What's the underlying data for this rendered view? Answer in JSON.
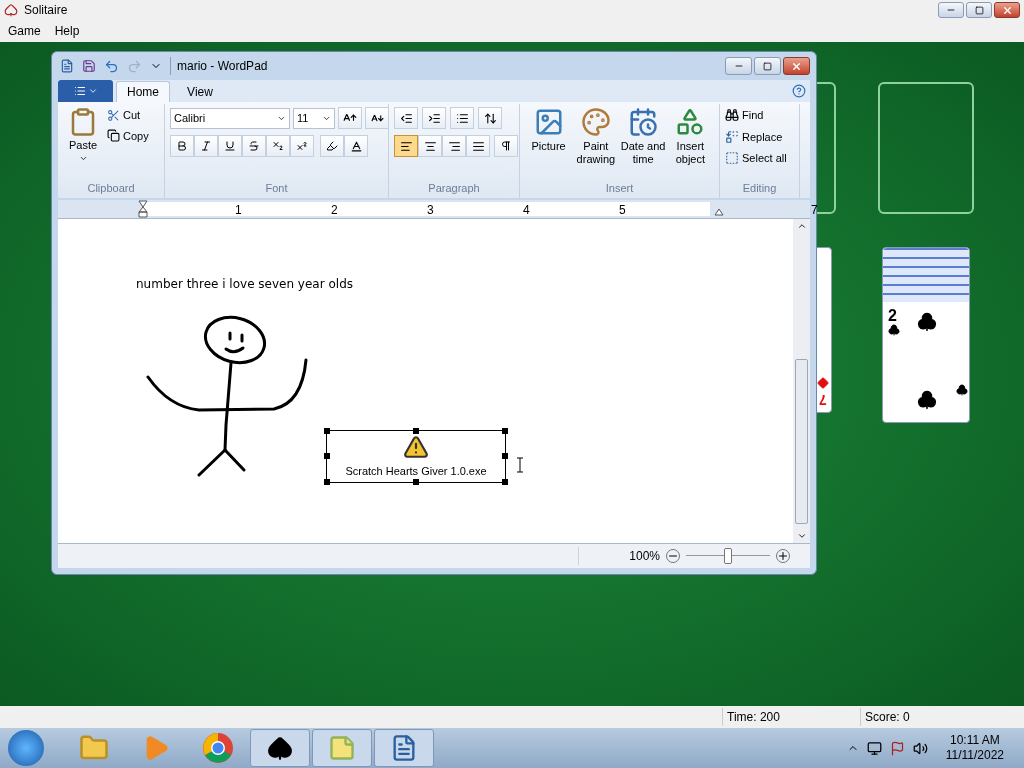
{
  "solitaire": {
    "title": "Solitaire",
    "menu": [
      "Game",
      "Help"
    ],
    "status": {
      "time": "Time:  200",
      "score": "Score: 0"
    }
  },
  "cards": {
    "partial_rank": "7",
    "rank": "2"
  },
  "wordpad": {
    "title": "mario - WordPad",
    "tabs": [
      {
        "label": "Home",
        "selected": true
      },
      {
        "label": "View",
        "selected": false
      }
    ],
    "clipboard": {
      "paste": "Paste",
      "cut": "Cut",
      "copy": "Copy",
      "label": "Clipboard"
    },
    "font": {
      "name": "Calibri",
      "size": "11",
      "label": "Font"
    },
    "paragraph": {
      "label": "Paragraph",
      "alignment": [
        {
          "selected": true
        },
        {
          "selected": false
        },
        {
          "selected": false
        },
        {
          "selected": false
        }
      ]
    },
    "insert": {
      "label": "Insert",
      "items": [
        {
          "kind": "picture",
          "label": "Picture"
        },
        {
          "kind": "paint",
          "label": "Paint drawing"
        },
        {
          "kind": "datetime",
          "label": "Date and time"
        },
        {
          "kind": "object",
          "label": "Insert object"
        }
      ]
    },
    "editing": {
      "label": "Editing",
      "items": [
        {
          "kind": "find",
          "label": "Find"
        },
        {
          "kind": "replace",
          "label": "Replace"
        },
        {
          "kind": "selectall",
          "label": "Select all"
        }
      ]
    },
    "ruler": [
      "1",
      "2",
      "3",
      "4",
      "5",
      "7"
    ],
    "document": {
      "text": "number three i love seven year olds",
      "attachment": {
        "label": "Scratch Hearts Giver 1.0.exe",
        "selected": true
      }
    },
    "zoom": {
      "reading": "100%",
      "level": 0.5
    }
  },
  "taskbar": {
    "apps": [
      {
        "kind": "folder",
        "open": false
      },
      {
        "kind": "media",
        "open": false
      },
      {
        "kind": "browser",
        "open": false
      },
      {
        "kind": "cards",
        "open": true
      },
      {
        "kind": "notes",
        "open": true
      },
      {
        "kind": "wordpad",
        "open": true
      }
    ],
    "clock": {
      "time": "10:11 AM",
      "date": "11/11/2022"
    }
  }
}
